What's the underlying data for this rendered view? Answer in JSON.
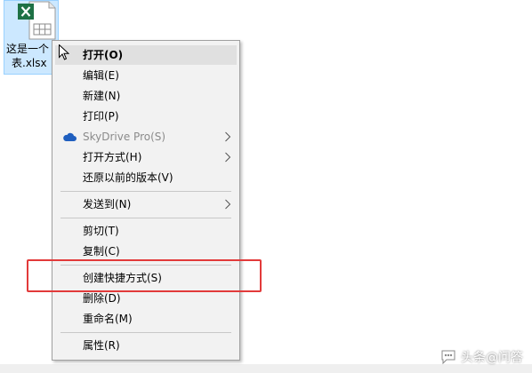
{
  "colors": {
    "menu_bg": "#f2f2f2",
    "menu_hover": "#e0e0e0",
    "highlight": "#e23a3a",
    "selection": "#cce8ff",
    "excel_green": "#1e7145"
  },
  "file": {
    "label_line1": "这是一个",
    "label_line2": "表.xlsx",
    "icon": "excel-file-icon"
  },
  "menu": {
    "items": [
      {
        "label": "打开(O)",
        "name": "menu-item-open"
      },
      {
        "label": "编辑(E)",
        "name": "menu-item-edit"
      },
      {
        "label": "新建(N)",
        "name": "menu-item-new"
      },
      {
        "label": "打印(P)",
        "name": "menu-item-print"
      },
      {
        "label": "SkyDrive Pro(S)",
        "name": "menu-item-skydrive-pro",
        "icon": "cloud-icon"
      },
      {
        "label": "打开方式(H)",
        "name": "menu-item-open-with"
      },
      {
        "label": "还原以前的版本(V)",
        "name": "menu-item-restore-previous-versions"
      },
      {
        "label": "发送到(N)",
        "name": "menu-item-send-to"
      },
      {
        "label": "剪切(T)",
        "name": "menu-item-cut"
      },
      {
        "label": "复制(C)",
        "name": "menu-item-copy"
      },
      {
        "label": "创建快捷方式(S)",
        "name": "menu-item-create-shortcut"
      },
      {
        "label": "删除(D)",
        "name": "menu-item-delete"
      },
      {
        "label": "重命名(M)",
        "name": "menu-item-rename"
      },
      {
        "label": "属性(R)",
        "name": "menu-item-properties"
      }
    ]
  },
  "watermark": {
    "text": "头条@问答"
  }
}
